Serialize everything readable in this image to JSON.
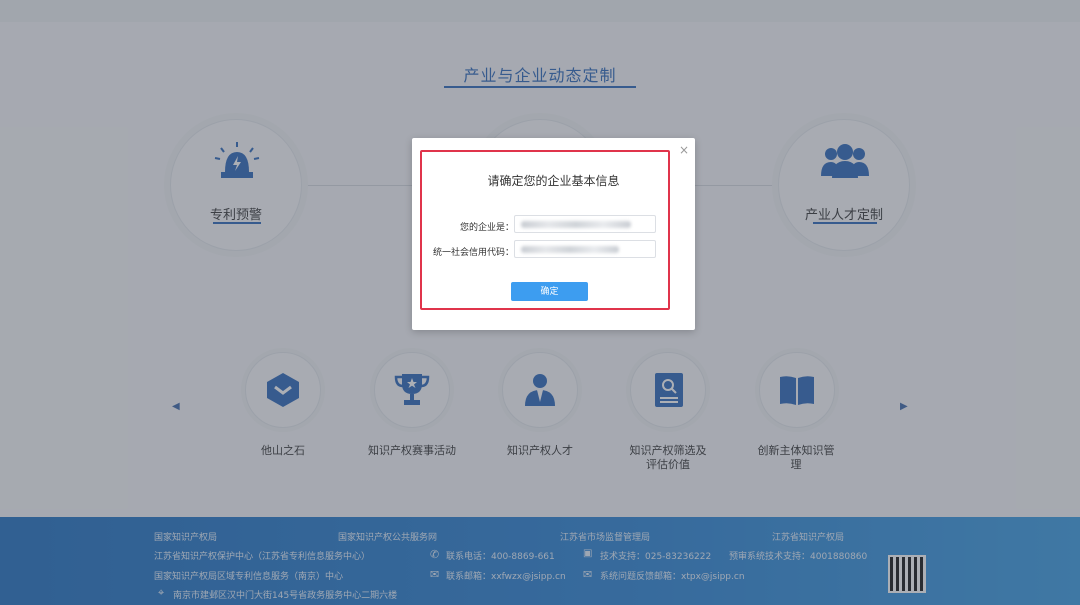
{
  "section": {
    "title": "产业与企业动态定制"
  },
  "big_cards": [
    {
      "label": "专利预警",
      "icon": "alarm-siren-icon"
    },
    {
      "label": "",
      "icon": ""
    },
    {
      "label": "产业人才定制",
      "icon": "people-group-icon"
    }
  ],
  "small_cards": [
    {
      "label": "他山之石",
      "icon": "hexagon-chevron-icon"
    },
    {
      "label": "知识产权赛事活动",
      "icon": "trophy-icon"
    },
    {
      "label": "知识产权人才",
      "icon": "person-suit-icon"
    },
    {
      "label": "知识产权筛选及评估价值",
      "icon": "document-search-icon"
    },
    {
      "label": "创新主体知识管理",
      "icon": "open-book-icon"
    }
  ],
  "footer": {
    "links": [
      "国家知识产权局",
      "国家知识产权公共服务网",
      "江苏省市场监督管理局",
      "江苏省知识产权局"
    ],
    "org_line1": "江苏省知识产权保护中心（江苏省专利信息服务中心）",
    "org_line2": "国家知识产权局区域专利信息服务（南京）中心",
    "address": "南京市建邺区汉中门大街145号省政务服务中心二期六楼",
    "phone": "联系电话：400-8869-661",
    "tech_support": "技术支持：025-83236222",
    "review_support": "预审系统技术支持：4001880860",
    "email": "联系邮箱：xxfwzx@jsipp.cn",
    "feedback_email": "系统问题反馈邮箱：xtpx@jsipp.cn"
  },
  "modal": {
    "title": "请确定您的企业基本信息",
    "company_label": "您的企业是：",
    "credit_label": "统一社会信用代码：",
    "confirm_label": "确定",
    "close_symbol": "×"
  },
  "colors": {
    "accent": "#2a66b8",
    "highlight": "#e0344b",
    "button": "#3d9df0",
    "footer": "#2b83d3"
  }
}
